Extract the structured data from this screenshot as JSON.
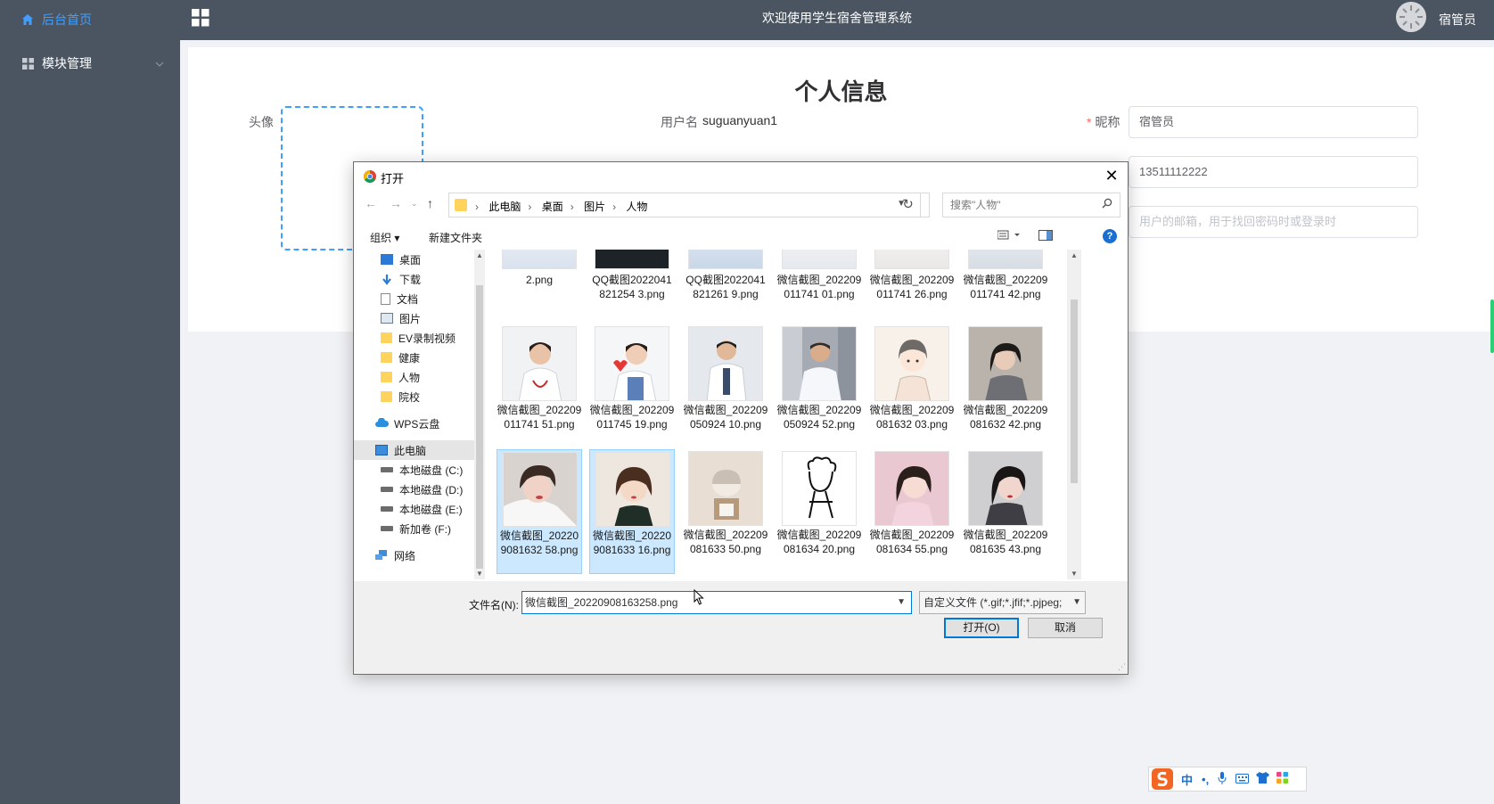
{
  "sidebar": {
    "items": [
      {
        "label": "后台首页",
        "icon": "home-icon",
        "active": true
      },
      {
        "label": "模块管理",
        "icon": "grid-icon",
        "active": false
      }
    ]
  },
  "topbar": {
    "title": "欢迎使用学生宿舍管理系统",
    "username": "宿管员"
  },
  "profile": {
    "heading": "个人信息",
    "avatar_label": "头像",
    "username_label": "用户名",
    "username_value": "suguanyuan1",
    "nickname_label": "昵称",
    "nickname_value": "宿管员",
    "phone_value": "13511112222",
    "email_placeholder": "用户的邮箱，用于找回密码时或登录时"
  },
  "dialog": {
    "title": "打开",
    "breadcrumbs": [
      "此电脑",
      "桌面",
      "图片",
      "人物"
    ],
    "search_placeholder": "搜索\"人物\"",
    "toolbar": {
      "organize": "组织 ▾",
      "new_folder": "新建文件夹"
    },
    "nav": [
      {
        "label": "桌面",
        "icon": "desktop-icon",
        "pinned": true
      },
      {
        "label": "下载",
        "icon": "download-icon",
        "pinned": true
      },
      {
        "label": "文档",
        "icon": "document-icon",
        "pinned": true
      },
      {
        "label": "图片",
        "icon": "pictures-icon",
        "pinned": true
      },
      {
        "label": "EV录制视频",
        "icon": "folder-icon"
      },
      {
        "label": "健康",
        "icon": "folder-icon"
      },
      {
        "label": "人物",
        "icon": "folder-icon"
      },
      {
        "label": "院校",
        "icon": "folder-icon"
      },
      {
        "label": "WPS云盘",
        "icon": "cloud-icon"
      },
      {
        "label": "此电脑",
        "icon": "computer-icon",
        "selected": true
      },
      {
        "label": "本地磁盘 (C:)",
        "icon": "drive-icon"
      },
      {
        "label": "本地磁盘 (D:)",
        "icon": "drive-icon"
      },
      {
        "label": "本地磁盘 (E:)",
        "icon": "drive-icon"
      },
      {
        "label": "新加卷 (F:)",
        "icon": "drive-icon"
      },
      {
        "label": "网络",
        "icon": "network-icon"
      }
    ],
    "files_row1": [
      {
        "name": "2.png"
      },
      {
        "name": "QQ截图2022041821254 3.png"
      },
      {
        "name": "QQ截图2022041821261 9.png"
      },
      {
        "name": "微信截图_202209011741 01.png"
      },
      {
        "name": "微信截图_202209011741 26.png"
      },
      {
        "name": "微信截图_202209011741 42.png"
      }
    ],
    "files_row2": [
      {
        "name": "微信截图_202209011741 51.png"
      },
      {
        "name": "微信截图_202209011745 19.png"
      },
      {
        "name": "微信截图_202209050924 10.png"
      },
      {
        "name": "微信截图_202209050924 52.png"
      },
      {
        "name": "微信截图_202209081632 03.png"
      },
      {
        "name": "微信截图_202209081632 42.png"
      }
    ],
    "files_row3": [
      {
        "name": "微信截图_202209081632 58.png",
        "selected": true
      },
      {
        "name": "微信截图_202209081633 16.png",
        "selected": true
      },
      {
        "name": "微信截图_202209081633 50.png"
      },
      {
        "name": "微信截图_202209081634 20.png"
      },
      {
        "name": "微信截图_202209081634 55.png"
      },
      {
        "name": "微信截图_202209081635 43.png"
      }
    ],
    "filename_label": "文件名(N):",
    "filename_value": "微信截图_20220908163258.png",
    "filetype_value": "自定义文件 (*.gif;*.jfif;*.pjpeg;",
    "open_button": "打开(O)",
    "cancel_button": "取消"
  },
  "ime": {
    "mode": "中",
    "punct": "•,"
  }
}
